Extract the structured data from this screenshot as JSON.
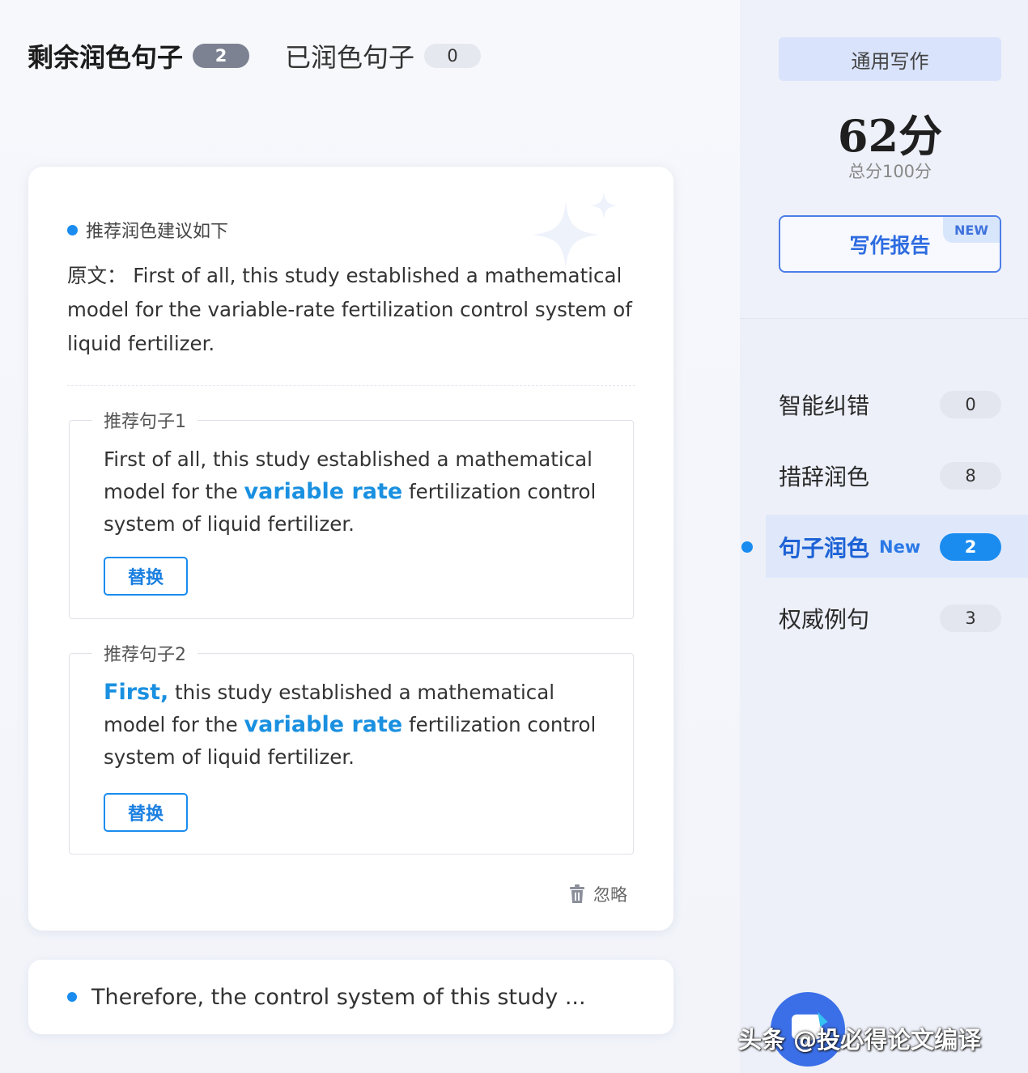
{
  "header": {
    "remaining_label": "剩余润色句子",
    "remaining_count": "2",
    "done_label": "已润色句子",
    "done_count": "0"
  },
  "card": {
    "heading": "推荐润色建议如下",
    "original": "原文：  First of all, this study established a mathematical model for the variable-rate fertilization control system of liquid fertilizer.",
    "suggestions": [
      {
        "legend": "推荐句子1",
        "parts": [
          "First of all, this study established a mathematical model for the ",
          "variable rate",
          " fertilization control system of liquid fertilizer."
        ],
        "replace_label": "替换"
      },
      {
        "legend": "推荐句子2",
        "parts": [
          "First,",
          " this study established a mathematical model for the ",
          "variable rate",
          " fertilization control system of liquid fertilizer."
        ],
        "replace_label": "替换"
      }
    ],
    "ignore_label": "忽略"
  },
  "next_card": {
    "text": "Therefore, the control system of this study ..."
  },
  "sidebar": {
    "mode_label": "通用写作",
    "score": "62分",
    "score_total": "总分100分",
    "report_label": "写作报告",
    "report_tag": "NEW",
    "nav": [
      {
        "label": "智能纠错",
        "count": "0"
      },
      {
        "label": "措辞润色",
        "count": "8"
      },
      {
        "label": "句子润色",
        "tag": "New",
        "count": "2"
      },
      {
        "label": "权威例句",
        "count": "3"
      }
    ]
  },
  "watermark": "头条 @投必得论文编译",
  "colors": {
    "accent": "#1a8cf0",
    "highlight": "#1a90e0",
    "panel": "#edf0f8"
  }
}
